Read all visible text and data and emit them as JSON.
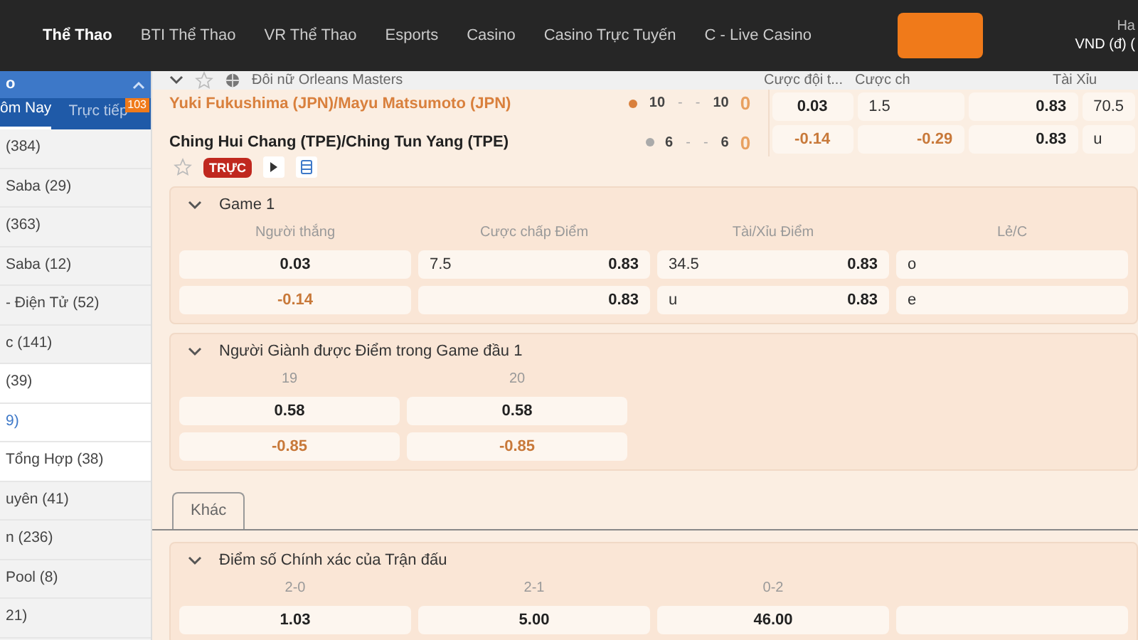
{
  "nav": {
    "items": [
      {
        "label": "Thể Thao",
        "selected": true
      },
      {
        "label": "BTI Thể Thao",
        "selected": false
      },
      {
        "label": "VR Thể Thao",
        "selected": false
      },
      {
        "label": "Esports",
        "selected": false
      },
      {
        "label": "Casino",
        "selected": false
      },
      {
        "label": "Casino Trực Tuyến",
        "selected": false
      },
      {
        "label": "C - Live Casino",
        "selected": false
      }
    ],
    "account": {
      "name": "Ha",
      "currency": "VND (đ) ("
    }
  },
  "sidebar": {
    "title": "o",
    "tabs": [
      {
        "label": "ôm Nay",
        "selected": true
      },
      {
        "label": "Trực tiếp",
        "selected": false,
        "badge": "103"
      }
    ],
    "items": [
      {
        "label": "(384)",
        "selected": false,
        "active": false
      },
      {
        "label": "Saba (29)",
        "selected": false,
        "active": false
      },
      {
        "label": "(363)",
        "selected": false,
        "active": false
      },
      {
        "label": "Saba (12)",
        "selected": false,
        "active": false
      },
      {
        "label": "- Điện Tử (52)",
        "selected": false,
        "active": false
      },
      {
        "label": "c (141)",
        "selected": false,
        "active": false
      },
      {
        "label": "(39)",
        "selected": true,
        "active": false
      },
      {
        "label": "9)",
        "selected": true,
        "active": true
      },
      {
        "label": "Tổng Hợp (38)",
        "selected": true,
        "active": false
      },
      {
        "label": "uyên (41)",
        "selected": false,
        "active": false
      },
      {
        "label": "n (236)",
        "selected": false,
        "active": false
      },
      {
        "label": "Pool (8)",
        "selected": false,
        "active": false
      },
      {
        "label": "21)",
        "selected": false,
        "active": false
      }
    ]
  },
  "league": {
    "name": "Đôi nữ Orleans Masters",
    "columns": [
      "Cược đội t...",
      "Cược ch",
      "Tài Xỉu"
    ]
  },
  "match": {
    "teams": [
      {
        "name": "Yuki Fukushima (JPN)/Mayu Matsumoto (JPN)",
        "serving": true,
        "scores": [
          "10",
          "-",
          "-",
          "10"
        ],
        "points": "0",
        "odds": [
          {
            "odds": "0.03",
            "negative": false
          },
          {
            "label": "1.5"
          },
          {
            "odds": "0.83",
            "negative": false
          },
          {
            "label": "70.5"
          }
        ]
      },
      {
        "name": "Ching Hui Chang (TPE)/Ching Tun Yang (TPE)",
        "serving": false,
        "scores": [
          "6",
          "-",
          "-",
          "6"
        ],
        "points": "0",
        "odds": [
          {
            "odds": "-0.14",
            "negative": true
          },
          {
            "odds": "-0.29",
            "negative": true
          },
          {
            "odds": "0.83",
            "negative": false
          },
          {
            "label": "u"
          }
        ]
      }
    ],
    "live_badge": "TRỰC"
  },
  "markets": [
    {
      "title": "Game 1",
      "expanded": true,
      "columns": [
        "Người thắng",
        "Cược chấp Điểm",
        "Tài/Xỉu Điểm",
        "Lẻ/C"
      ],
      "rows": [
        [
          {
            "odds": "0.03",
            "negative": false
          },
          {
            "label": "7.5",
            "odds": "0.83",
            "negative": false
          },
          {
            "label": "34.5",
            "odds": "0.83",
            "negative": false
          },
          {
            "label": "o"
          }
        ],
        [
          {
            "odds": "-0.14",
            "negative": true
          },
          {
            "odds": "0.83",
            "negative": false
          },
          {
            "label": "u",
            "odds": "0.83",
            "negative": false
          },
          {
            "label": "e"
          }
        ]
      ]
    },
    {
      "title": "Người Giành được Điểm trong Game đầu 1",
      "expanded": true,
      "columns": [
        "19",
        "20"
      ],
      "rows": [
        [
          {
            "odds": "0.58",
            "negative": false
          },
          {
            "odds": "0.58",
            "negative": false
          }
        ],
        [
          {
            "odds": "-0.85",
            "negative": true
          },
          {
            "odds": "-0.85",
            "negative": true
          }
        ]
      ]
    }
  ],
  "tabs": [
    {
      "label": "Khác",
      "selected": true
    }
  ],
  "bottom_market": {
    "title": "Điểm số Chính xác của Trận đấu",
    "expanded": true,
    "columns": [
      "2-0",
      "2-1",
      "0-2"
    ],
    "rows": [
      [
        {
          "odds": "1.03",
          "negative": false
        },
        {
          "odds": "5.00",
          "negative": false
        },
        {
          "odds": "46.00",
          "negative": false
        }
      ]
    ]
  }
}
